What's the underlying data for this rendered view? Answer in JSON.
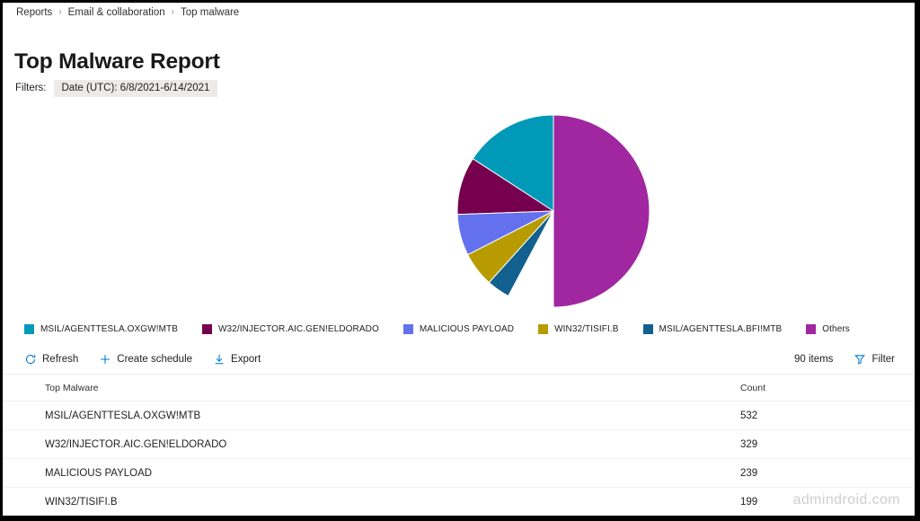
{
  "breadcrumb": {
    "separator": "›",
    "items": [
      {
        "label": "Reports"
      },
      {
        "label": "Email & collaboration"
      },
      {
        "label": "Top malware"
      }
    ]
  },
  "header": {
    "title": "Top Malware Report"
  },
  "filters": {
    "label": "Filters:",
    "pills": [
      {
        "text": "Date (UTC): 6/8/2021-6/14/2021"
      }
    ]
  },
  "commandbar": {
    "refresh_label": "Refresh",
    "refresh_icon": "refresh-icon",
    "create_schedule_label": "Create schedule",
    "create_schedule_icon": "plus-icon",
    "export_label": "Export",
    "export_icon": "download-icon",
    "items_count": "90 items",
    "filter_label": "Filter",
    "filter_icon": "funnel-icon"
  },
  "table": {
    "columns": [
      "Top Malware",
      "Count"
    ],
    "rows": [
      {
        "name": "MSIL/AGENTTESLA.OXGW!MTB",
        "count": "532"
      },
      {
        "name": "W32/INJECTOR.AIC.GEN!ELDORADO",
        "count": "329"
      },
      {
        "name": "MALICIOUS PAYLOAD",
        "count": "239"
      },
      {
        "name": "WIN32/TISIFI.B",
        "count": "199"
      }
    ]
  },
  "watermark": {
    "text": "admindroid.com"
  },
  "chart_data": {
    "type": "pie",
    "title": "Top Malware Report",
    "legend_position": "bottom-left",
    "start_angle_deg": 0,
    "direction": "counterclockwise",
    "labels": [
      "MSIL/AGENTTESLA.OXGW!MTB",
      "W32/INJECTOR.AIC.GEN!ELDORADO",
      "MALICIOUS PAYLOAD",
      "WIN32/TISIFI.B",
      "MSIL/AGENTTESLA.BFI!MTB",
      "Others"
    ],
    "values": [
      532,
      329,
      239,
      199,
      130,
      2035
    ],
    "percents": [
      15.8,
      9.8,
      7.1,
      5.9,
      3.9,
      57.5
    ],
    "slice_angles_deg": [
      57,
      35,
      25,
      21,
      14,
      180
    ],
    "colors": [
      "#0099b8",
      "#76004d",
      "#6471ef",
      "#b89b00",
      "#12608f",
      "#a0279f"
    ],
    "slices": [
      {
        "label": "MSIL/AGENTTESLA.OXGW!MTB",
        "value": 532,
        "color": "#0099b8"
      },
      {
        "label": "W32/INJECTOR.AIC.GEN!ELDORADO",
        "value": 329,
        "color": "#76004d"
      },
      {
        "label": "MALICIOUS PAYLOAD",
        "value": 239,
        "color": "#6471ef"
      },
      {
        "label": "WIN32/TISIFI.B",
        "value": 199,
        "color": "#b89b00"
      },
      {
        "label": "MSIL/AGENTTESLA.BFI!MTB",
        "value": 130,
        "color": "#12608f"
      },
      {
        "label": "Others",
        "value": 2035,
        "color": "#a0279f"
      }
    ]
  }
}
